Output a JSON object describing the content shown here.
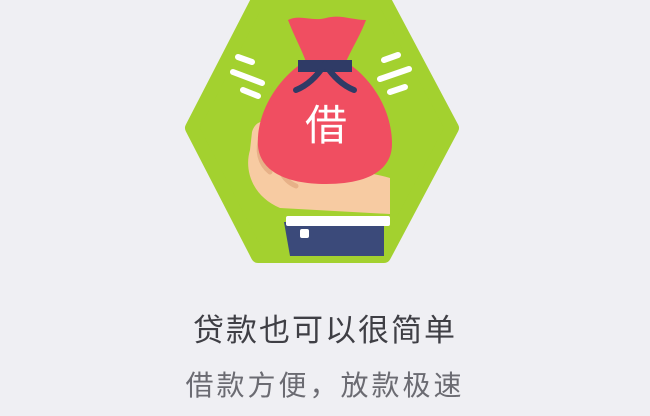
{
  "onboarding": {
    "illustration": {
      "icon": "money-bag-in-hand-icon",
      "bag_character": "借",
      "colors": {
        "hexagon": "#a3d12f",
        "bag": "#f04e61",
        "tie": "#2f3b66",
        "hand": "#f7cba2",
        "cuff": "#ffffff",
        "sleeve": "#3b4a7a"
      }
    },
    "headline": "贷款也可以很简单",
    "subline": "借款方便，放款极速"
  }
}
